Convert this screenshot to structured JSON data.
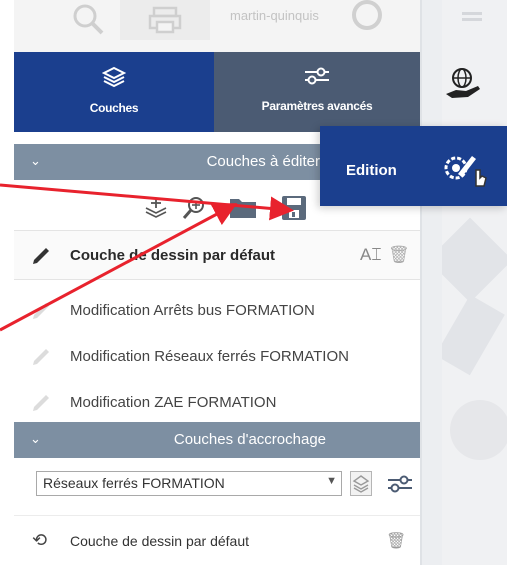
{
  "topbar": {
    "user": "martin-quinquis",
    "icons": [
      "search-icon",
      "print-icon",
      "user-ring-icon",
      "menu-icon"
    ]
  },
  "tabs": [
    {
      "label": "Couches",
      "icon": "layers-icon",
      "active": true
    },
    {
      "label": "Paramètres avancés",
      "icon": "sliders-icon",
      "active": false
    }
  ],
  "edition": {
    "label": "Edition",
    "icon": "gear-pen-icon",
    "cursor": "hand-cursor-icon"
  },
  "globe_button": {
    "icon": "globe-hand-icon"
  },
  "layers_to_edit": {
    "title": "Couches à éditer",
    "toolbar": [
      "add-layer-icon",
      "zoom-layer-icon",
      "folder-icon",
      "save-icon"
    ],
    "rows": [
      {
        "label": "Couche de dessin par défaut",
        "selected": true,
        "actions": [
          "text-tool-icon",
          "trash-icon"
        ]
      },
      {
        "label": "Modification Arrêts bus FORMATION",
        "selected": false
      },
      {
        "label": "Modification Réseaux ferrés FORMATION",
        "selected": false
      },
      {
        "label": "Modification ZAE FORMATION",
        "selected": false
      }
    ]
  },
  "snapping": {
    "title": "Couches d'accrochage",
    "select_value": "Réseaux ferrés FORMATION",
    "rows": [
      {
        "label": "Couche de dessin par défaut",
        "icon": "snap-icon"
      }
    ]
  },
  "colors": {
    "primary": "#1b3f8e",
    "secondary": "#4b5b73",
    "section": "#7d8fa2",
    "annotation": "#e8222d"
  }
}
